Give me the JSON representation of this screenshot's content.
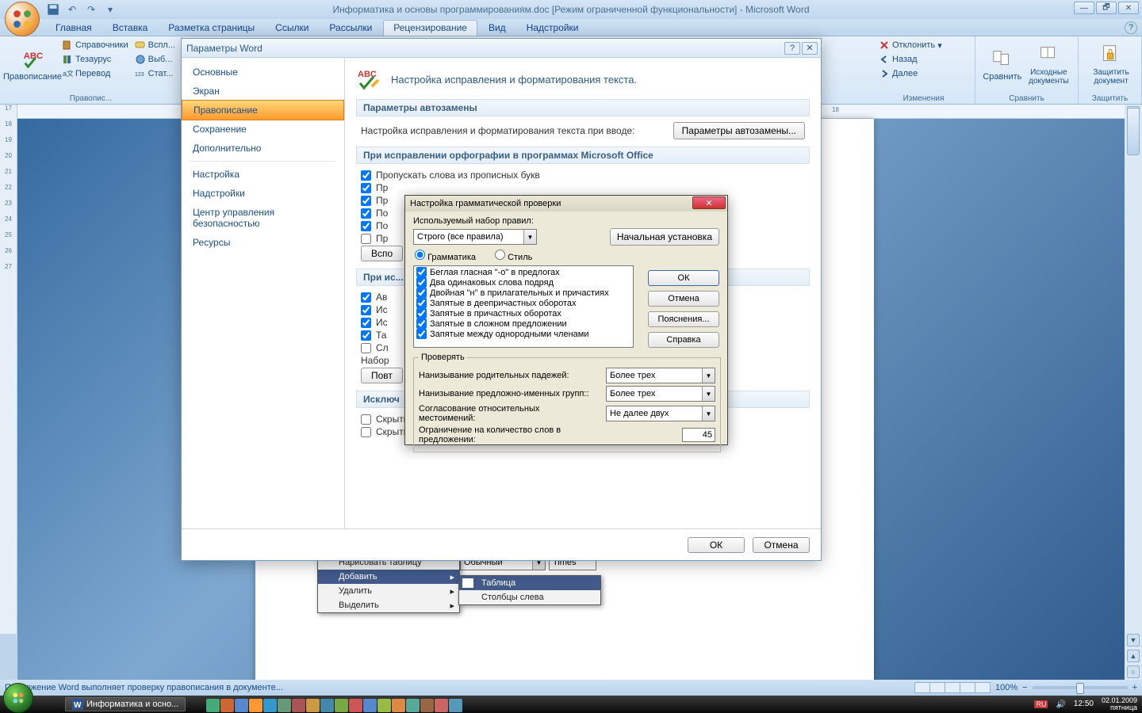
{
  "window": {
    "title": "Информатика и основы программированиям.doc [Режим ограниченной функциональности] - Microsoft Word"
  },
  "ribbon": {
    "tabs": [
      "Главная",
      "Вставка",
      "Разметка страницы",
      "Ссылки",
      "Рассылки",
      "Рецензирование",
      "Вид",
      "Надстройки"
    ],
    "active": 5,
    "groups": {
      "proofing": {
        "big": "Правописание",
        "items": [
          "Справочники",
          "Тезаурус",
          "Перевод"
        ],
        "col2": [
          "Вспл...",
          "Выб...",
          "Стат..."
        ],
        "label": "Правопис..."
      },
      "changes": {
        "items": [
          "Отклонить",
          "Назад",
          "Далее"
        ],
        "label": "Изменения"
      },
      "compare": {
        "items": [
          "Сравнить",
          "Исходные документы"
        ],
        "label": "Сравнить"
      },
      "protect": {
        "items": [
          "Защитить документ"
        ],
        "label": "Защитить"
      }
    }
  },
  "ruler_h_marker": "18",
  "dialog": {
    "title": "Параметры Word",
    "nav": [
      "Основные",
      "Экран",
      "Правописание",
      "Сохранение",
      "Дополнительно",
      "Настройка",
      "Надстройки",
      "Центр управления безопасностью",
      "Ресурсы"
    ],
    "nav_active": 2,
    "pane": {
      "heading": "Настройка исправления и форматирования текста.",
      "sec_autocorrect": "Параметры автозамены",
      "autocorrect_line": "Настройка исправления и форматирования текста при вводе:",
      "autocorrect_btn": "Параметры автозамены...",
      "sec_spell_office": "При исправлении орфографии в программах Microsoft Office",
      "spell_opts": [
        "Пропускать слова из прописных букв",
        "Пр",
        "Пр",
        "По",
        "По",
        "Пр"
      ],
      "aux_btn": "Вспо",
      "sec_spell_word": "При ис...",
      "word_opts": [
        "Ав",
        "Ис",
        "Ис",
        "Та",
        "Сл"
      ],
      "nabor_label": "Набор",
      "recheck_btn": "Повт",
      "sec_except": "Исключ",
      "except_opts": [
        "Скрыть орфографические ошибки только в этом документе",
        "Скрыть грамматические ошибки только в этом документе"
      ],
      "ok": "ОК",
      "cancel": "Отмена"
    }
  },
  "grammar": {
    "title": "Настройка грамматической проверки",
    "ruleset_label": "Используемый набор правил:",
    "ruleset_combo": "Строго (все правила)",
    "reset_btn": "Начальная установка",
    "radio_grammar": "Грамматика",
    "radio_style": "Стиль",
    "rules": [
      "Беглая гласная \"-о\" в предлогах",
      "Два одинаковых слова подряд",
      "Двойная \"н\" в прилагательных и причастиях",
      "Запятые в деепричастных оборотах",
      "Запятые в причастных оборотах",
      "Запятые в сложном предложении",
      "Запятые между однородными членами"
    ],
    "btns": {
      "ok": "ОК",
      "cancel": "Отмена",
      "explain": "Пояснения...",
      "help": "Справка"
    },
    "check_legend": "Проверять",
    "check_rows": [
      {
        "label": "Нанизывание родительных падежей:",
        "value": "Более трех"
      },
      {
        "label": "Нанизывание предложно-именных групп::",
        "value": "Более трех"
      },
      {
        "label": "Согласование относительных местоимений:",
        "value": "Не далее двух"
      }
    ],
    "limit_label": "Ограничение на количество слов в предложении:",
    "limit_value": "45"
  },
  "context": {
    "menu1": [
      "Нарисовать таблицу",
      "Добавить",
      "Удалить",
      "Выделить"
    ],
    "menu1_style": "Обычный",
    "menu1_font": "Times",
    "menu2": [
      "Таблица",
      "Столбцы слева"
    ]
  },
  "statusbar": {
    "left": "Приложение Word выполняет проверку правописания в документе...",
    "zoom": "100%"
  },
  "taskbar": {
    "app": "Информатика и осно...",
    "time": "12:50",
    "date": "02.01.2009",
    "day": "пятница"
  }
}
